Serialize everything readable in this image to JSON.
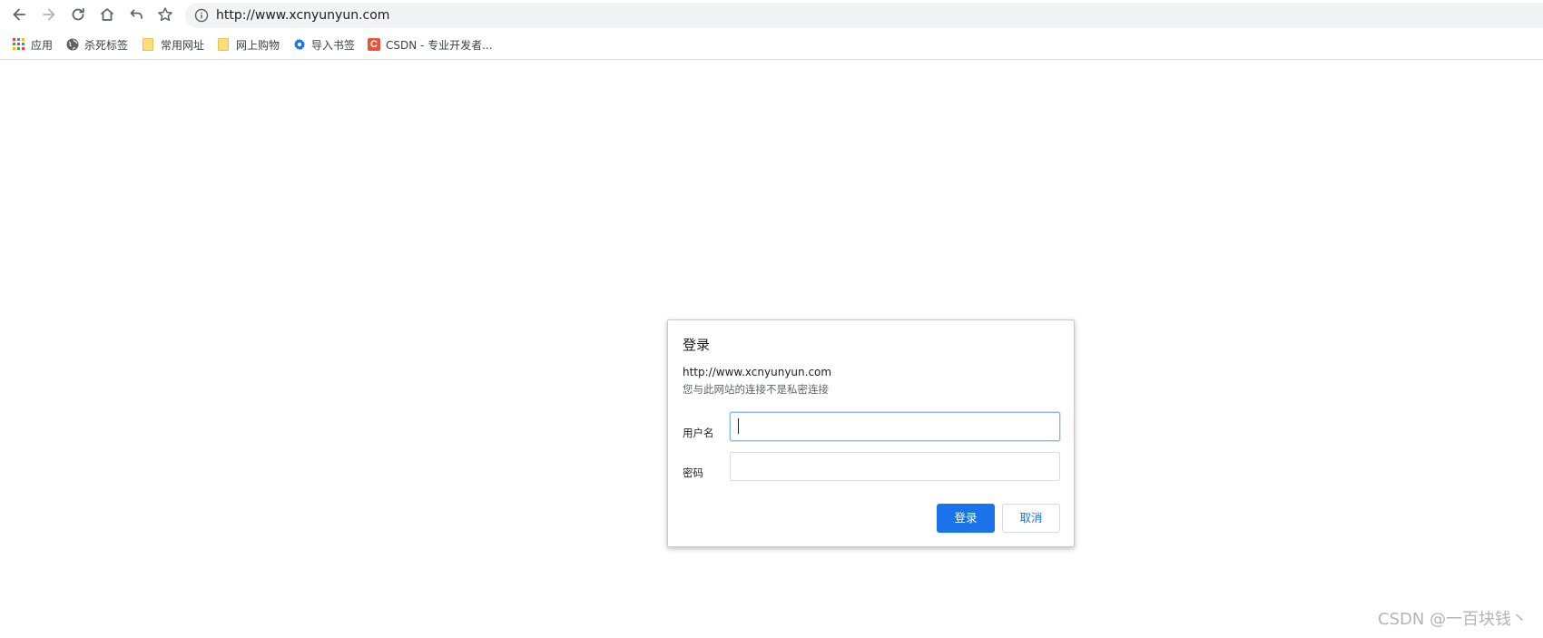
{
  "toolbar": {
    "url": "http://www.xcnyunyun.com",
    "icons": [
      "back-arrow-icon",
      "forward-arrow-icon",
      "reload-icon",
      "home-icon",
      "undo-icon",
      "star-icon",
      "info-icon"
    ]
  },
  "bookmarks": {
    "items": [
      {
        "label": "应用",
        "icon": "apps-grid-icon"
      },
      {
        "label": "杀死标签",
        "icon": "globe-icon"
      },
      {
        "label": "常用网址",
        "icon": "folder-icon"
      },
      {
        "label": "网上购物",
        "icon": "folder-icon"
      },
      {
        "label": "导入书签",
        "icon": "gear-icon"
      },
      {
        "label": "CSDN - 专业开发者...",
        "icon": "csdn-icon"
      }
    ]
  },
  "dialog": {
    "title": "登录",
    "site_url": "http://www.xcnyunyun.com",
    "warning": "您与此网站的连接不是私密连接",
    "username_label": "用户名",
    "username_value": "",
    "password_label": "密码",
    "password_value": "",
    "login_button": "登录",
    "cancel_button": "取消"
  },
  "watermark": "CSDN @一百块钱丶",
  "colors": {
    "accent": "#1a73e8",
    "omnibox_bg": "#f1f3f4",
    "focus_border": "#8ab4f8",
    "csdn_red": "#e8543b",
    "folder_yellow": "#fbdd7e"
  }
}
